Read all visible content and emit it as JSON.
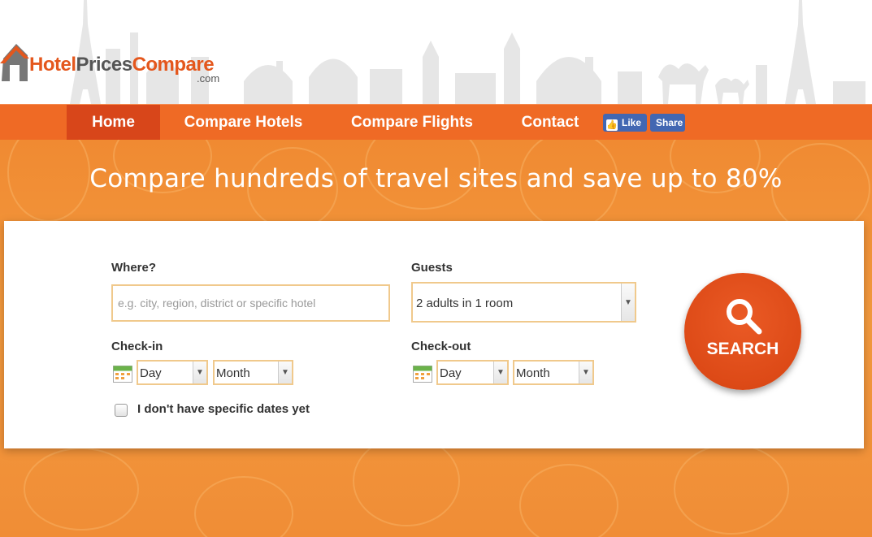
{
  "logo": {
    "part1": "Hotel",
    "part2": "Prices",
    "part3": "Compare",
    "suffix": ".com"
  },
  "nav": {
    "items": [
      {
        "label": "Home",
        "active": true
      },
      {
        "label": "Compare Hotels",
        "active": false
      },
      {
        "label": "Compare Flights",
        "active": false
      },
      {
        "label": "Contact",
        "active": false
      }
    ],
    "fb_like": "Like",
    "fb_share": "Share"
  },
  "hero": {
    "headline": "Compare hundreds of travel sites and save up to 80%"
  },
  "search": {
    "where_label": "Where?",
    "where_placeholder": "e.g. city, region, district or specific hotel",
    "guests_label": "Guests",
    "guests_value": "2 adults in 1 room",
    "checkin_label": "Check-in",
    "checkout_label": "Check-out",
    "checkin_day": "Day",
    "checkin_month": "Month",
    "checkout_day": "Day",
    "checkout_month": "Month",
    "no_dates_label": "I don't have specific dates yet",
    "no_dates_checked": false,
    "button_label": "SEARCH"
  },
  "colors": {
    "brand_orange": "#ef6a25",
    "active_nav": "#d8461a",
    "search_red": "#dd4a17",
    "facebook_blue": "#4267b2"
  },
  "icons": [
    "house-logo-icon",
    "facebook-thumb-icon",
    "calendar-icon",
    "chevron-down-icon",
    "search-magnifier-icon"
  ]
}
